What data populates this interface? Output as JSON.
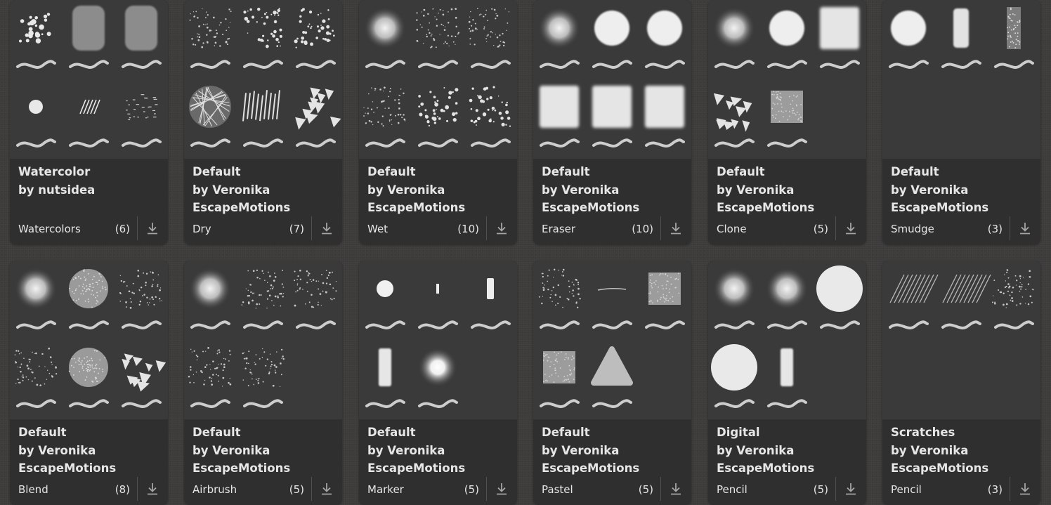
{
  "cards": [
    {
      "line1": "Watercolor",
      "line2": "by nutsidea",
      "line3": "",
      "category": "Watercolors",
      "count": "(6)",
      "preview": [
        [
          "blobs",
          "blurrect",
          "blurrect"
        ],
        [
          "dot",
          "hatch",
          "textnoise"
        ]
      ]
    },
    {
      "line1": "Default",
      "line2": "by Veronika",
      "line3": "EscapeMotions",
      "category": "Dry",
      "count": "(7)",
      "preview": [
        [
          "specks",
          "splatter",
          "splatter"
        ],
        [
          "mesh",
          "streaks",
          "shards"
        ]
      ]
    },
    {
      "line1": "Default",
      "line2": "by Veronika",
      "line3": "EscapeMotions",
      "category": "Wet",
      "count": "(10)",
      "preview": [
        [
          "softcircle",
          "specks",
          "specks"
        ],
        [
          "specks",
          "splatter",
          "splatter"
        ]
      ]
    },
    {
      "line1": "Default",
      "line2": "by Veronika",
      "line3": "EscapeMotions",
      "category": "Eraser",
      "count": "(10)",
      "preview": [
        [
          "softcircle",
          "circle",
          "circle"
        ],
        [
          "square",
          "square",
          "square"
        ]
      ]
    },
    {
      "line1": "Default",
      "line2": "by Veronika",
      "line3": "EscapeMotions",
      "category": "Clone",
      "count": "(5)",
      "preview": [
        [
          "softcircle",
          "circle",
          "square"
        ],
        [
          "shards",
          "noisesquare"
        ]
      ]
    },
    {
      "line1": "Default",
      "line2": "by Veronika",
      "line3": "EscapeMotions",
      "category": "Smudge",
      "count": "(3)",
      "preview": [
        [
          "circle",
          "tallrough",
          "tallnoise"
        ]
      ]
    },
    {
      "line1": "Default",
      "line2": "by Veronika",
      "line3": "EscapeMotions",
      "category": "Blend",
      "count": "(8)",
      "preview": [
        [
          "softcircle",
          "noisecircle",
          "specks"
        ],
        [
          "specks",
          "noisecircle",
          "shards"
        ]
      ]
    },
    {
      "line1": "Default",
      "line2": "by Veronika",
      "line3": "EscapeMotions",
      "category": "Airbrush",
      "count": "(5)",
      "preview": [
        [
          "softcircle",
          "specks",
          "specks"
        ],
        [
          "specks",
          "specks"
        ]
      ]
    },
    {
      "line1": "Default",
      "line2": "by Veronika",
      "line3": "EscapeMotions",
      "category": "Marker",
      "count": "(5)",
      "preview": [
        [
          "smalldot",
          "tinybar",
          "bar"
        ],
        [
          "tallbar",
          "glowcircle"
        ]
      ]
    },
    {
      "line1": "Default",
      "line2": "by Veronika",
      "line3": "EscapeMotions",
      "category": "Pastel",
      "count": "(5)",
      "preview": [
        [
          "specks",
          "thinline",
          "noisesquare"
        ],
        [
          "noisesquare",
          "triangle"
        ]
      ]
    },
    {
      "line1": "Digital",
      "line2": "by Veronika",
      "line3": "EscapeMotions",
      "category": "Pencil",
      "count": "(5)",
      "preview": [
        [
          "softcircle",
          "softcircle",
          "bigcircle"
        ],
        [
          "bigcircle",
          "tallbar"
        ]
      ]
    },
    {
      "line1": "Scratches",
      "line2": "by Veronika",
      "line3": "EscapeMotions",
      "category": "Pencil",
      "count": "(3)",
      "preview": [
        [
          "diaglines",
          "diaglines",
          "specks"
        ]
      ]
    }
  ],
  "icons": {
    "download": "download-icon"
  },
  "colors": {
    "card": "#2f2f2f",
    "preview": "#3a3a3a",
    "text": "#e6e6e6",
    "background": "#3e3c3a"
  }
}
